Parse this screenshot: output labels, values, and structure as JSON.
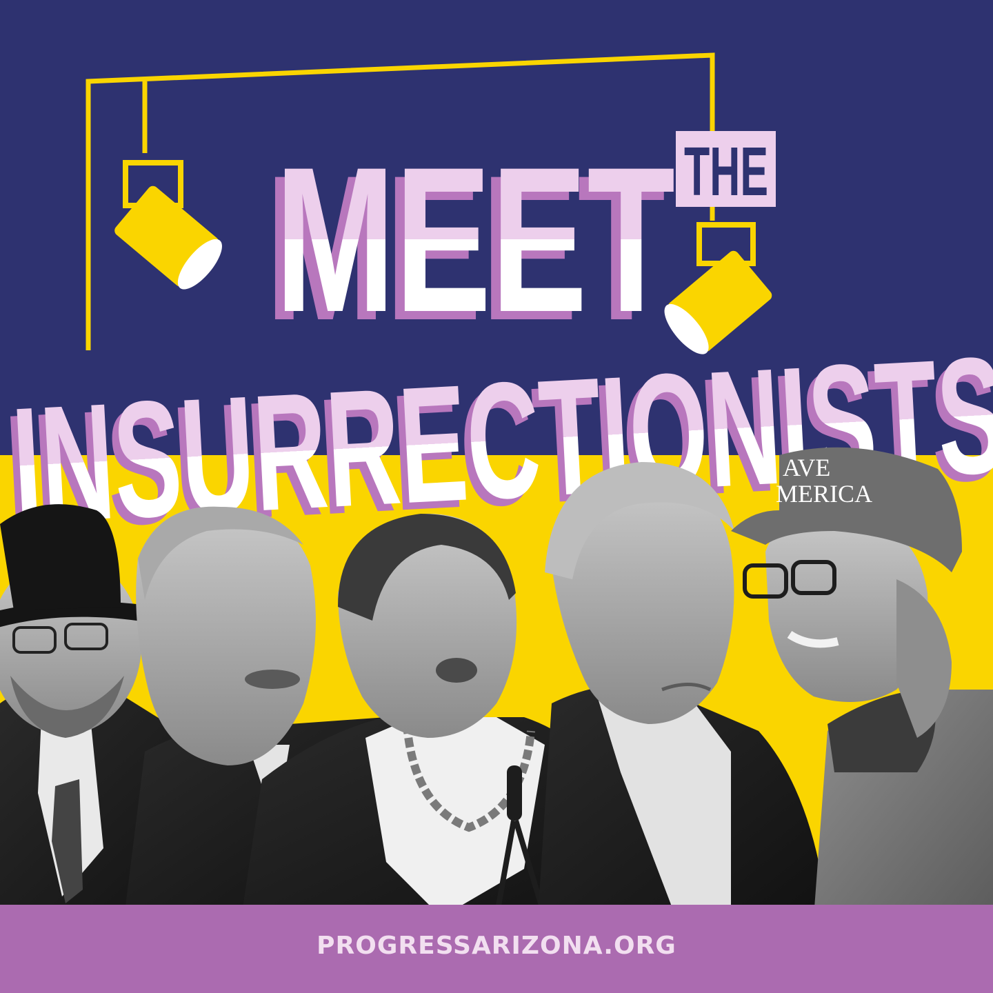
{
  "headline": {
    "line1": "MEET",
    "connector": "THE",
    "line2": "INSURRECTIONISTS"
  },
  "portraits": [
    {
      "name": "person-cowboy-hat",
      "hat_text": ""
    },
    {
      "name": "person-older-man",
      "hat_text": ""
    },
    {
      "name": "person-woman-microphone",
      "hat_text": ""
    },
    {
      "name": "person-man-gray-hair",
      "hat_text": ""
    },
    {
      "name": "person-woman-red-cap",
      "hat_text": "AVE\nMERICA"
    }
  ],
  "footer": {
    "url": "PROGRESSARIZONA.ORG"
  },
  "colors": {
    "navy": "#2e3270",
    "yellow": "#fad500",
    "purple": "#ab6bb0",
    "lavender": "#edcfec",
    "white": "#ffffff",
    "shadow_purple": "#b877bd"
  },
  "icons": [
    "spotlight-icon",
    "spotlight-icon"
  ]
}
